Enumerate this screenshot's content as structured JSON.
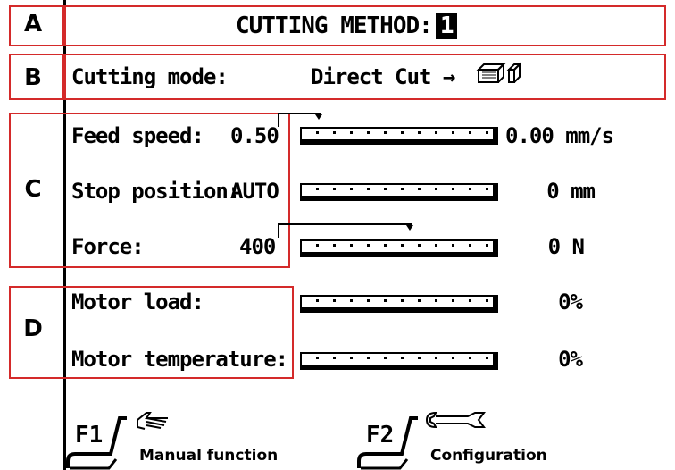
{
  "header": {
    "title": "CUTTING METHOD:",
    "method_number": "1"
  },
  "section_labels": [
    "A",
    "B",
    "C",
    "D"
  ],
  "mode": {
    "label": "Cutting mode:",
    "value": "Direct Cut →"
  },
  "parameters": [
    {
      "label": "Feed speed:",
      "value": "0.50",
      "reading": "0.00 mm/s",
      "bar_fraction": 0
    },
    {
      "label": "Stop position:",
      "value": "AUTO",
      "reading": "0 mm",
      "bar_fraction": 0
    },
    {
      "label": "Force:",
      "value": "400",
      "reading": "0 N",
      "bar_fraction": 0
    }
  ],
  "motor": [
    {
      "label": "Motor load:",
      "reading": "0%",
      "bar_fraction": 0
    },
    {
      "label": "Motor temperature:",
      "reading": "0%",
      "bar_fraction": 0
    }
  ],
  "function_keys": [
    {
      "key": "F1",
      "label": "Manual function",
      "icon": "hand-pointing-icon"
    },
    {
      "key": "F2",
      "label": "Configuration",
      "icon": "wrench-icon"
    }
  ],
  "colors": {
    "annotation_box": "#d42a2a",
    "foreground": "#000000",
    "background": "#ffffff"
  }
}
